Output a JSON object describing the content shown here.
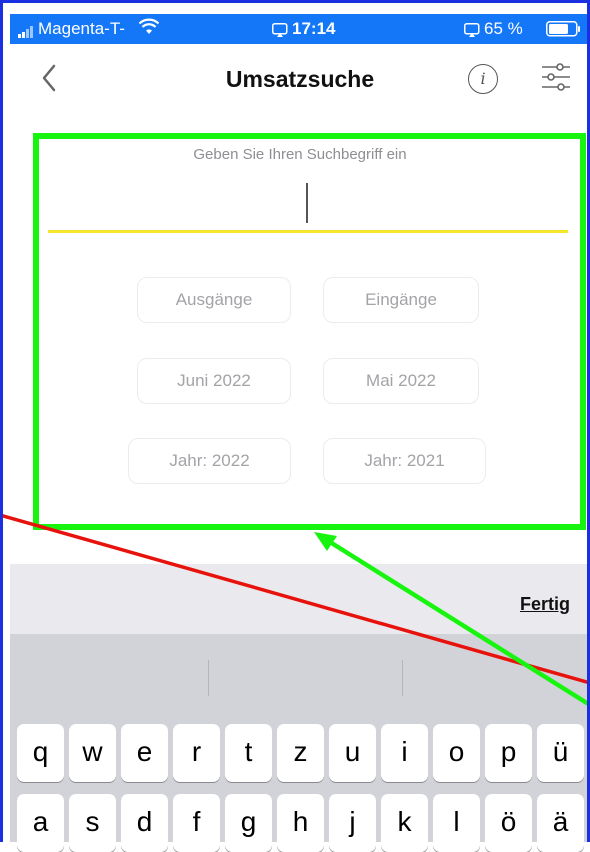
{
  "status_bar": {
    "carrier": "Magenta-T-",
    "time": "17:14",
    "battery": "65 %",
    "signal_icon": "signal-bars-icon",
    "wifi_icon": "wifi-icon",
    "battery_icon": "battery-icon"
  },
  "nav": {
    "title": "Umsatzsuche",
    "back_icon": "chevron-left-icon",
    "info_icon": "info-icon",
    "info_glyph": "i",
    "filter_icon": "sliders-icon"
  },
  "search": {
    "placeholder": "Geben Sie Ihren Suchbegriff ein",
    "value": ""
  },
  "filters": {
    "row1": [
      "Ausgänge",
      "Eingänge"
    ],
    "row2": [
      "Juni 2022",
      "Mai 2022"
    ],
    "row3": [
      "Jahr: 2022",
      "Jahr: 2021"
    ]
  },
  "keyboard": {
    "done_label": "Fertig",
    "row1": [
      "q",
      "w",
      "e",
      "r",
      "t",
      "z",
      "u",
      "i",
      "o",
      "p",
      "ü"
    ],
    "row2": [
      "a",
      "s",
      "d",
      "f",
      "g",
      "h",
      "j",
      "k",
      "l",
      "ö",
      "ä"
    ]
  },
  "colors": {
    "status_bar": "#1477f8",
    "accent_line": "#f6e52a",
    "highlight_box": "#17f50f",
    "annotation_line": "#e8120c",
    "border": "#1a2fe0"
  }
}
